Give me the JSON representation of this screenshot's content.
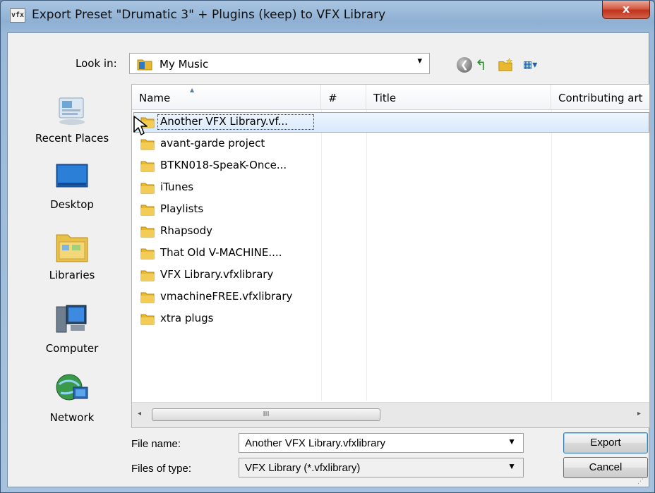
{
  "window": {
    "title": "Export Preset \"Drumatic 3\" + Plugins (keep) to VFX Library",
    "app_icon_text": "vfx",
    "close_glyph": "x"
  },
  "lookin": {
    "label": "Look in:",
    "value": "My Music",
    "arrow": "▾"
  },
  "toolbar": {
    "icons": [
      "back-icon",
      "up-folder-icon",
      "new-folder-icon",
      "views-menu-icon"
    ],
    "back_glyph": "❮",
    "up_glyph": "↰",
    "views_glyph": "▦▾"
  },
  "places": [
    {
      "label": "Recent Places",
      "icon": "recent-places-icon"
    },
    {
      "label": "Desktop",
      "icon": "desktop-icon"
    },
    {
      "label": "Libraries",
      "icon": "libraries-icon"
    },
    {
      "label": "Computer",
      "icon": "computer-icon"
    },
    {
      "label": "Network",
      "icon": "network-icon"
    }
  ],
  "columns": {
    "name": "Name",
    "number": "#",
    "title": "Title",
    "contributing": "Contributing art"
  },
  "files": [
    {
      "name": "Another VFX Library.vf...",
      "selected": true
    },
    {
      "name": "avant-garde project"
    },
    {
      "name": "BTKN018-SpeaK-Once..."
    },
    {
      "name": "iTunes"
    },
    {
      "name": "Playlists"
    },
    {
      "name": "Rhapsody"
    },
    {
      "name": "That Old V-MACHINE...."
    },
    {
      "name": "VFX Library.vfxlibrary"
    },
    {
      "name": "vmachineFREE.vfxlibrary"
    },
    {
      "name": "xtra plugs"
    }
  ],
  "scrollbar": {
    "left_arrow": "◂",
    "right_arrow": "▸",
    "thumb_grip": "III"
  },
  "filename": {
    "label": "File name:",
    "value": "Another VFX Library.vfxlibrary",
    "arrow": "▼"
  },
  "filetype": {
    "label": "Files of type:",
    "value": "VFX Library (*.vfxlibrary)",
    "arrow": "▼"
  },
  "buttons": {
    "export": "Export",
    "cancel": "Cancel"
  },
  "colors": {
    "folder": "#e8b830",
    "selection": "#d9e9fb",
    "close_button": "#c2331c"
  }
}
